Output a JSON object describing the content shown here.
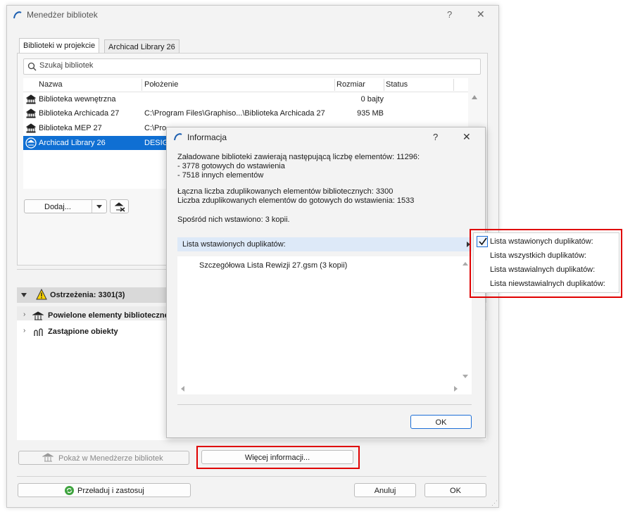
{
  "main_window": {
    "title": "Menedżer bibliotek",
    "help": "?",
    "close": "✕",
    "tabs": [
      {
        "label": "Biblioteki w projekcie",
        "active": true
      },
      {
        "label": "Archicad Library 26",
        "active": false
      }
    ],
    "search_placeholder": "Szukaj bibliotek",
    "columns": [
      "Nazwa",
      "Położenie",
      "Rozmiar",
      "Status"
    ],
    "rows": [
      {
        "name": "Biblioteka wewnętrzna",
        "location": "",
        "size": "0 bajty"
      },
      {
        "name": "Biblioteka Archicada 27",
        "location": "C:\\Program Files\\Graphiso...\\Biblioteka Archicada 27",
        "size": "935 MB"
      },
      {
        "name": "Biblioteka MEP 27",
        "location": "C:\\Pro",
        "size": ""
      },
      {
        "name": "Archicad Library 26",
        "location": "DESIG",
        "size": "",
        "selected": true
      }
    ],
    "add_button": "Dodaj...",
    "warnings_label": "Ostrzeżenia: 3301(3)",
    "tree_items": [
      "Powielone elementy biblioteczne",
      "Zastąpione obiekty"
    ],
    "show_in_manager": "Pokaż w Menedżerze bibliotek",
    "more_info": "Więcej informacji...",
    "reload": "Przeładuj i zastosuj",
    "cancel": "Anuluj",
    "ok": "OK"
  },
  "info_dialog": {
    "title": "Informacja",
    "help": "?",
    "close": "✕",
    "lines1": [
      "Załadowane biblioteki zawierają następującą liczbę elementów: 11296:",
      "- 3778 gotowych do wstawienia",
      "- 7518 innych elementów"
    ],
    "lines2": [
      "Łączna liczba zduplikowanych elementów bibliotecznych: 3300",
      "Liczba zduplikowanych elementów do gotowych do wstawienia: 1533"
    ],
    "lines3": "Spośród nich wstawiono: 3 kopii.",
    "dropdown_label": "Lista wstawionych duplikatów:",
    "list_item": "Szczegółowa Lista Rewizji 27.gsm (3 kopii)",
    "ok": "OK"
  },
  "dropdown_menu": {
    "items": [
      {
        "label": "Lista wstawionych duplikatów:",
        "checked": true
      },
      {
        "label": "Lista wszystkich duplikatów:",
        "checked": false
      },
      {
        "label": "Lista wstawialnych duplikatów:",
        "checked": false
      },
      {
        "label": "Lista niewstawialnych duplikatów:",
        "checked": false
      }
    ]
  }
}
